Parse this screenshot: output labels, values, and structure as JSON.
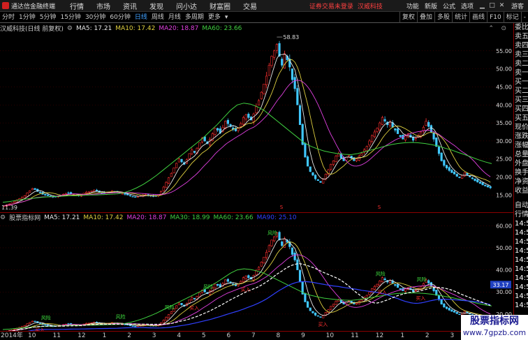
{
  "app": {
    "title": "通达信金融终端",
    "menu": [
      "行情",
      "市场",
      "资讯",
      "发现",
      "问小达",
      "财富圈",
      "交易"
    ],
    "login_warning": "证券交易未登录",
    "stock_name": "汉威科技",
    "top_menu": [
      "功能",
      "新版",
      "公式",
      "选项"
    ],
    "guest": "游客"
  },
  "periods": [
    "分时",
    "1分钟",
    "5分钟",
    "15分钟",
    "30分钟",
    "60分钟",
    "日线",
    "周线",
    "月线",
    "多周期",
    "更多"
  ],
  "active_period": "日线",
  "tools": [
    "复权",
    "叠加",
    "多股",
    "统计",
    "画线",
    "F10",
    "标记",
    "-"
  ],
  "colors": {
    "up": "#ff3030",
    "down": "#40c8ff",
    "ma5": "#e8e8e8",
    "ma10": "#e0d040",
    "ma20": "#e040e0",
    "ma30": "#40d040",
    "ma60": "#40d040",
    "ma90": "#3040ff"
  },
  "main_legend": {
    "title": "汉威科技(日线 前复权)",
    "ma5": "MA5: 17.21",
    "ma10": "MA10: 17.42",
    "ma20": "MA20: 18.87",
    "ma60": "MA60: 23.66"
  },
  "sub_legend": {
    "title": "股票指标网",
    "ma5": "MA5: 17.21",
    "ma10": "MA10: 17.42",
    "ma20": "MA20: 18.87",
    "ma30": "MA30: 18.99",
    "ma60": "MA60: 23.66",
    "ma90": "MA90: 25.10"
  },
  "chart_data": {
    "type": "candlestick",
    "main_yticks": [
      "55.00",
      "50.00",
      "45.00",
      "40.00",
      "35.00",
      "30.00",
      "25.00",
      "20.00",
      "15.00"
    ],
    "main_ylim": [
      11,
      60
    ],
    "max_label": "58.83",
    "min_label": "11.39",
    "sub_yticks": [
      "60.00",
      "50.00",
      "40.00",
      "30.00",
      "20.00"
    ],
    "sub_ylim": [
      13,
      62
    ],
    "sub_price_label": "33.17",
    "signal_label": "买入",
    "peak_label": "风险",
    "x_labels": [
      "2014年",
      "10",
      "11",
      "12",
      "1",
      "2",
      "3",
      "4",
      "5",
      "6",
      "7",
      "8",
      "9",
      "10",
      "11",
      "12",
      "1",
      "2",
      "3",
      "4"
    ],
    "close_series": [
      12.0,
      12.3,
      12.5,
      12.8,
      13.2,
      13.6,
      14.0,
      14.3,
      14.8,
      15.6,
      16.2,
      16.8,
      16.5,
      16.0,
      15.6,
      15.2,
      15.0,
      14.8,
      14.6,
      14.4,
      14.5,
      14.7,
      14.9,
      15.2,
      15.4,
      15.6,
      15.3,
      15.1,
      15.0,
      14.9,
      15.2,
      15.5,
      15.8,
      15.9,
      16.1,
      16.3,
      16.0,
      15.8,
      15.6,
      15.5,
      15.7,
      15.9,
      16.2,
      16.0,
      15.8,
      15.6,
      15.4,
      15.2,
      15.0,
      14.8,
      14.6,
      14.5,
      14.6,
      14.8,
      15.0,
      15.1,
      14.9,
      14.7,
      14.6,
      14.8,
      15.2,
      16.0,
      17.2,
      18.5,
      19.8,
      21.0,
      22.5,
      23.8,
      25.0,
      24.2,
      23.5,
      24.8,
      26.5,
      27.5,
      26.8,
      28.0,
      29.5,
      30.8,
      30.0,
      29.2,
      30.5,
      32.0,
      33.5,
      33.0,
      32.2,
      33.8,
      35.5,
      34.8,
      34.0,
      33.2,
      32.8,
      33.5,
      34.8,
      36.5,
      37.2,
      36.5,
      35.8,
      37.5,
      39.5,
      41.2,
      43.5,
      45.8,
      48.0,
      51.0,
      53.5,
      55.0,
      56.8,
      53.5,
      51.0,
      54.2,
      52.5,
      50.5,
      47.0,
      44.5,
      40.0,
      34.5,
      29.0,
      25.5,
      23.0,
      21.5,
      20.5,
      19.5,
      19.0,
      18.5,
      19.5,
      20.8,
      22.0,
      23.5,
      24.5,
      25.8,
      26.5,
      25.2,
      24.5,
      25.5,
      26.0,
      25.2,
      24.5,
      25.0,
      25.8,
      26.5,
      27.5,
      28.5,
      30.0,
      31.5,
      32.5,
      33.5,
      35.0,
      36.5,
      35.5,
      34.5,
      35.2,
      33.8,
      33.0,
      32.0,
      31.2,
      30.5,
      31.5,
      32.0,
      31.0,
      30.2,
      30.8,
      31.5,
      32.5,
      33.8,
      35.5,
      34.0,
      32.5,
      30.5,
      28.5,
      26.5,
      24.5,
      23.2,
      22.5,
      21.8,
      21.2,
      20.8,
      20.2,
      19.8,
      20.5,
      21.2,
      20.6,
      20.0,
      19.5,
      19.0,
      18.6,
      18.2,
      17.8,
      17.5,
      17.2,
      17.0
    ],
    "ma60_series": [
      13.0,
      13.2,
      13.5,
      13.8,
      14.0,
      14.2,
      14.4,
      14.5,
      14.6,
      14.7,
      14.8,
      14.8,
      14.9,
      15.0,
      15.0,
      15.1,
      15.2,
      15.3,
      15.6,
      16.2,
      17.0,
      18.0,
      19.2,
      20.5,
      22.0,
      23.5,
      25.0,
      26.5,
      28.0,
      29.5,
      31.0,
      32.8,
      34.5,
      36.5,
      38.5,
      40.0,
      40.5,
      40.2,
      39.5,
      38.5,
      37.0,
      35.5,
      34.0,
      32.5,
      31.0,
      29.5,
      28.5,
      27.8,
      27.2,
      26.8,
      26.5,
      26.3,
      26.2,
      26.5,
      27.0,
      27.5,
      28.0,
      28.5,
      29.0,
      29.3,
      29.5,
      29.6,
      29.5,
      29.3,
      29.0,
      28.6,
      28.0,
      27.5,
      26.8,
      26.2,
      25.5,
      24.8,
      24.2,
      23.7
    ]
  }
}
